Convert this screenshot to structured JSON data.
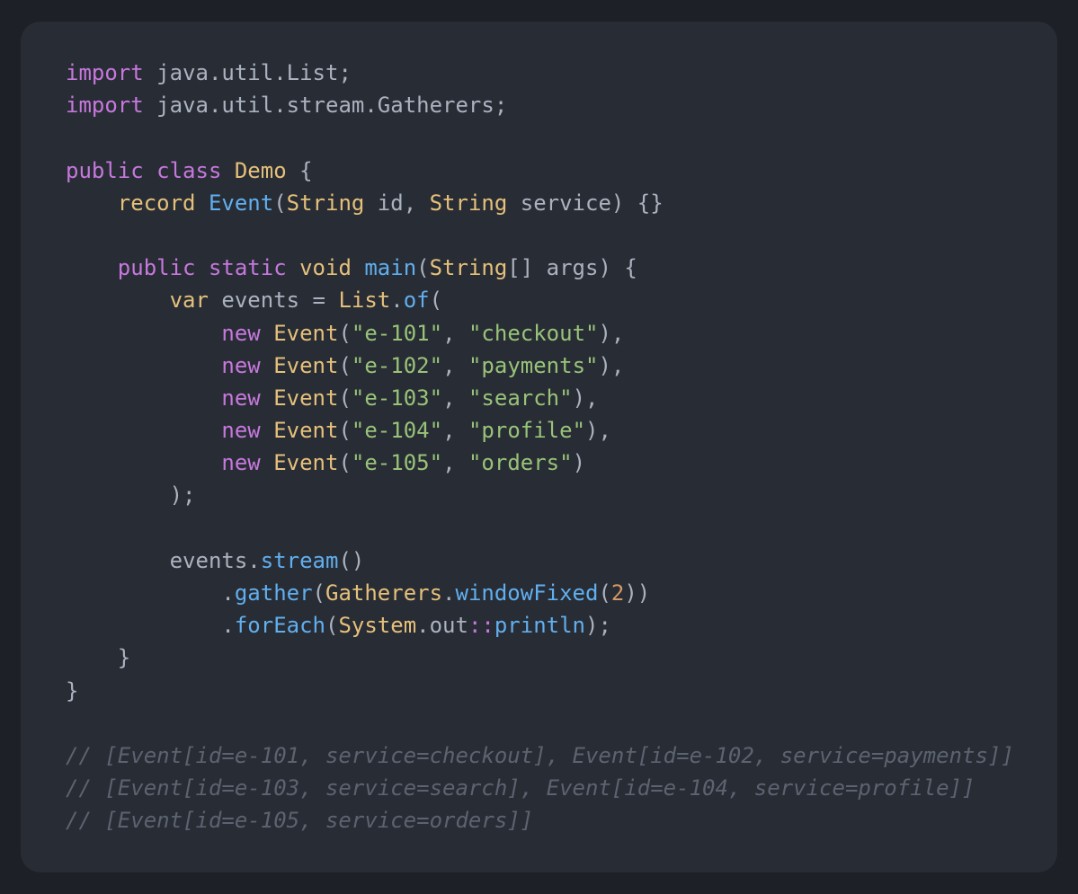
{
  "colors": {
    "background": "#1d2027",
    "card": "#282c34",
    "keyword": "#c678dd",
    "type": "#e5c07b",
    "function": "#61afef",
    "string": "#98c379",
    "number": "#d19a66",
    "plain": "#abb2bf",
    "comment": "#5c6370"
  },
  "code_lines": [
    [
      [
        "k",
        "import"
      ],
      [
        "p",
        " java.util.List;"
      ]
    ],
    [
      [
        "k",
        "import"
      ],
      [
        "p",
        " java.util.stream.Gatherers;"
      ]
    ],
    [],
    [
      [
        "k",
        "public class"
      ],
      [
        "p",
        " "
      ],
      [
        "t",
        "Demo"
      ],
      [
        "p",
        " {"
      ]
    ],
    [
      [
        "p",
        "    "
      ],
      [
        "t",
        "record"
      ],
      [
        "p",
        " "
      ],
      [
        "f",
        "Event"
      ],
      [
        "p",
        "("
      ],
      [
        "t",
        "String"
      ],
      [
        "p",
        " id, "
      ],
      [
        "t",
        "String"
      ],
      [
        "p",
        " service) {}"
      ]
    ],
    [],
    [
      [
        "p",
        "    "
      ],
      [
        "k",
        "public static"
      ],
      [
        "p",
        " "
      ],
      [
        "t",
        "void"
      ],
      [
        "p",
        " "
      ],
      [
        "f",
        "main"
      ],
      [
        "p",
        "("
      ],
      [
        "t",
        "String"
      ],
      [
        "p",
        "[] args) {"
      ]
    ],
    [
      [
        "p",
        "        "
      ],
      [
        "t",
        "var"
      ],
      [
        "p",
        " events = "
      ],
      [
        "t",
        "List"
      ],
      [
        "p",
        "."
      ],
      [
        "f",
        "of"
      ],
      [
        "p",
        "("
      ]
    ],
    [
      [
        "p",
        "            "
      ],
      [
        "k",
        "new"
      ],
      [
        "p",
        " "
      ],
      [
        "t",
        "Event"
      ],
      [
        "p",
        "("
      ],
      [
        "s",
        "\"e-101\""
      ],
      [
        "p",
        ", "
      ],
      [
        "s",
        "\"checkout\""
      ],
      [
        "p",
        "),"
      ]
    ],
    [
      [
        "p",
        "            "
      ],
      [
        "k",
        "new"
      ],
      [
        "p",
        " "
      ],
      [
        "t",
        "Event"
      ],
      [
        "p",
        "("
      ],
      [
        "s",
        "\"e-102\""
      ],
      [
        "p",
        ", "
      ],
      [
        "s",
        "\"payments\""
      ],
      [
        "p",
        "),"
      ]
    ],
    [
      [
        "p",
        "            "
      ],
      [
        "k",
        "new"
      ],
      [
        "p",
        " "
      ],
      [
        "t",
        "Event"
      ],
      [
        "p",
        "("
      ],
      [
        "s",
        "\"e-103\""
      ],
      [
        "p",
        ", "
      ],
      [
        "s",
        "\"search\""
      ],
      [
        "p",
        "),"
      ]
    ],
    [
      [
        "p",
        "            "
      ],
      [
        "k",
        "new"
      ],
      [
        "p",
        " "
      ],
      [
        "t",
        "Event"
      ],
      [
        "p",
        "("
      ],
      [
        "s",
        "\"e-104\""
      ],
      [
        "p",
        ", "
      ],
      [
        "s",
        "\"profile\""
      ],
      [
        "p",
        "),"
      ]
    ],
    [
      [
        "p",
        "            "
      ],
      [
        "k",
        "new"
      ],
      [
        "p",
        " "
      ],
      [
        "t",
        "Event"
      ],
      [
        "p",
        "("
      ],
      [
        "s",
        "\"e-105\""
      ],
      [
        "p",
        ", "
      ],
      [
        "s",
        "\"orders\""
      ],
      [
        "p",
        ")"
      ]
    ],
    [
      [
        "p",
        "        );"
      ]
    ],
    [],
    [
      [
        "p",
        "        events."
      ],
      [
        "f",
        "stream"
      ],
      [
        "p",
        "()"
      ]
    ],
    [
      [
        "p",
        "            ."
      ],
      [
        "f",
        "gather"
      ],
      [
        "p",
        "("
      ],
      [
        "t",
        "Gatherers"
      ],
      [
        "p",
        "."
      ],
      [
        "f",
        "windowFixed"
      ],
      [
        "p",
        "("
      ],
      [
        "n",
        "2"
      ],
      [
        "p",
        "))"
      ]
    ],
    [
      [
        "p",
        "            ."
      ],
      [
        "f",
        "forEach"
      ],
      [
        "p",
        "("
      ],
      [
        "t",
        "System"
      ],
      [
        "p",
        ".out"
      ],
      [
        "k",
        "::"
      ],
      [
        "f",
        "println"
      ],
      [
        "p",
        ");"
      ]
    ],
    [
      [
        "p",
        "    }"
      ]
    ],
    [
      [
        "p",
        "}"
      ]
    ],
    [],
    [
      [
        "c",
        "// [Event[id=e-101, service=checkout], Event[id=e-102, service=payments]]"
      ]
    ],
    [
      [
        "c",
        "// [Event[id=e-103, service=search], Event[id=e-104, service=profile]]"
      ]
    ],
    [
      [
        "c",
        "// [Event[id=e-105, service=orders]]"
      ]
    ]
  ]
}
